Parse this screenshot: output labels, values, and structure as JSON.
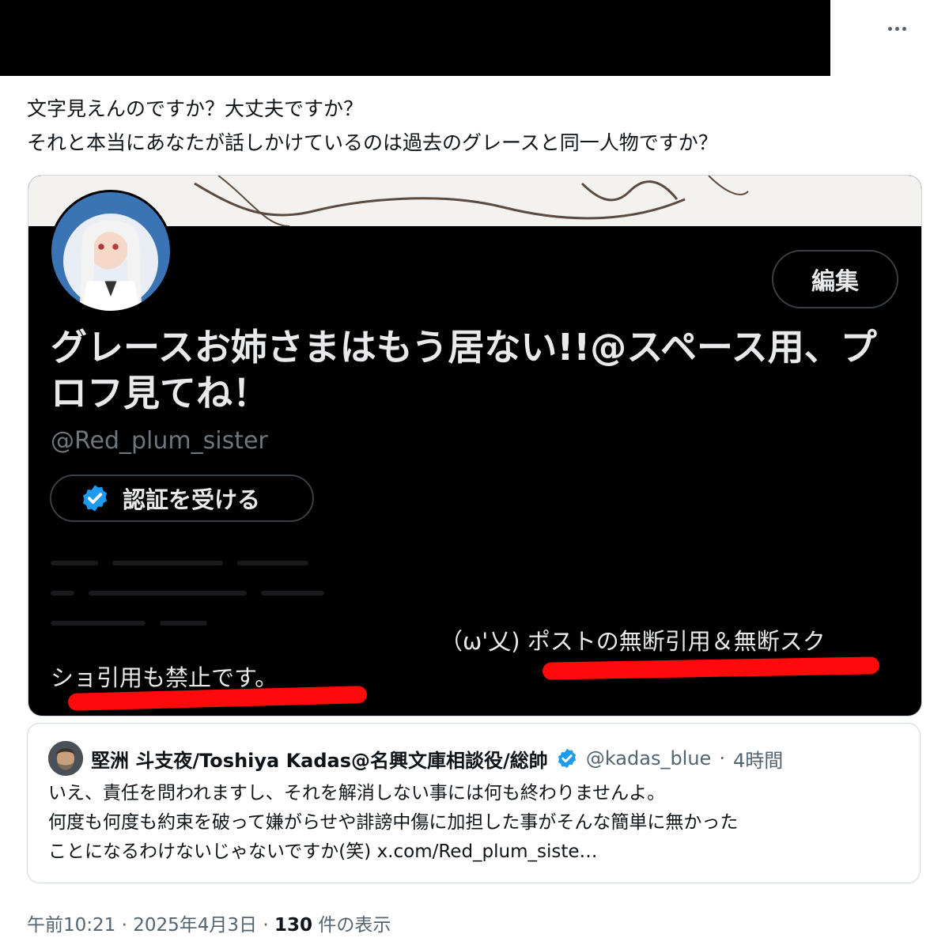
{
  "post": {
    "text_lines": [
      "文字見えんのですか？大丈夫ですか？",
      "それと本当にあなたが話しかけているのは過去のグレースと同一人物ですか？"
    ],
    "more_icon": "more-horizontal-icon"
  },
  "media": {
    "edit_label": "編集",
    "profile_name": "グレースお姉さまはもう居ない!!@スペース用、プロフ見てね！",
    "handle": "@Red_plum_sister",
    "verify_label": "認証を受ける",
    "bio_line1": "（ω'乂) ポストの無断引用＆無断スク",
    "bio_line2": "ショ引用も禁止です。",
    "highlight_color": "#ff0a0a"
  },
  "quote": {
    "name": "堅洲 斗支夜/Toshiya Kadas@名興文庫相談役/総帥",
    "handle": "@kadas_blue",
    "separator": "·",
    "time": "4時間",
    "lines": [
      "いえ、責任を問われますし、それを解消しない事には何も終わりませんよ。",
      "何度も何度も約束を破って嫌がらせや誹謗中傷に加担した事がそんな簡単に無かった",
      "ことになるわけないじゃないですか(笑) x.com/Red_plum_siste…"
    ]
  },
  "meta": {
    "time": "午前10:21",
    "separator": "·",
    "date": "2025年4月3日",
    "views": "130",
    "views_label": "件の表示"
  }
}
